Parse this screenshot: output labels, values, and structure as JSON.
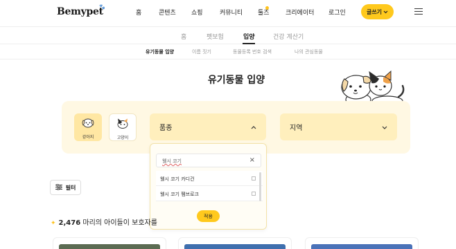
{
  "logo": "Bemypet",
  "top_nav": {
    "items": [
      "홈",
      "콘텐츠",
      "쇼핑",
      "커뮤니티",
      "툴즈",
      "크리에이터",
      "로그인"
    ],
    "write_button": "글쓰기",
    "highlight_item": "툴즈"
  },
  "sub_nav": {
    "items": [
      "홈",
      "펫보험",
      "입양",
      "건강 계산기"
    ],
    "active": "입양"
  },
  "third_nav": {
    "items": [
      "유기동물 입양",
      "이름 짓기",
      "동물등록 번호 검색",
      "나의 관심동물"
    ],
    "active": "유기동물 입양"
  },
  "page_title": "유기동물 입양",
  "filters": {
    "species": [
      {
        "label": "강아지",
        "icon": "dog-face-icon",
        "selected": true
      },
      {
        "label": "고양이",
        "icon": "cat-face-icon",
        "selected": false
      }
    ],
    "breed_label": "품종",
    "region_label": "지역"
  },
  "breed_popover": {
    "search_value": "웰시 코기",
    "options": [
      "웰시 코기 카디건",
      "웰시 코기 펨브로크"
    ],
    "apply_label": "적용"
  },
  "filter_button": "필터",
  "result": {
    "count": "2,476",
    "text": "마리의 아이들이 보호자를"
  },
  "colors": {
    "accent": "#ffc91d",
    "panel_bg": "#fff8e3",
    "dropdown_bg": "#ffefbd"
  }
}
